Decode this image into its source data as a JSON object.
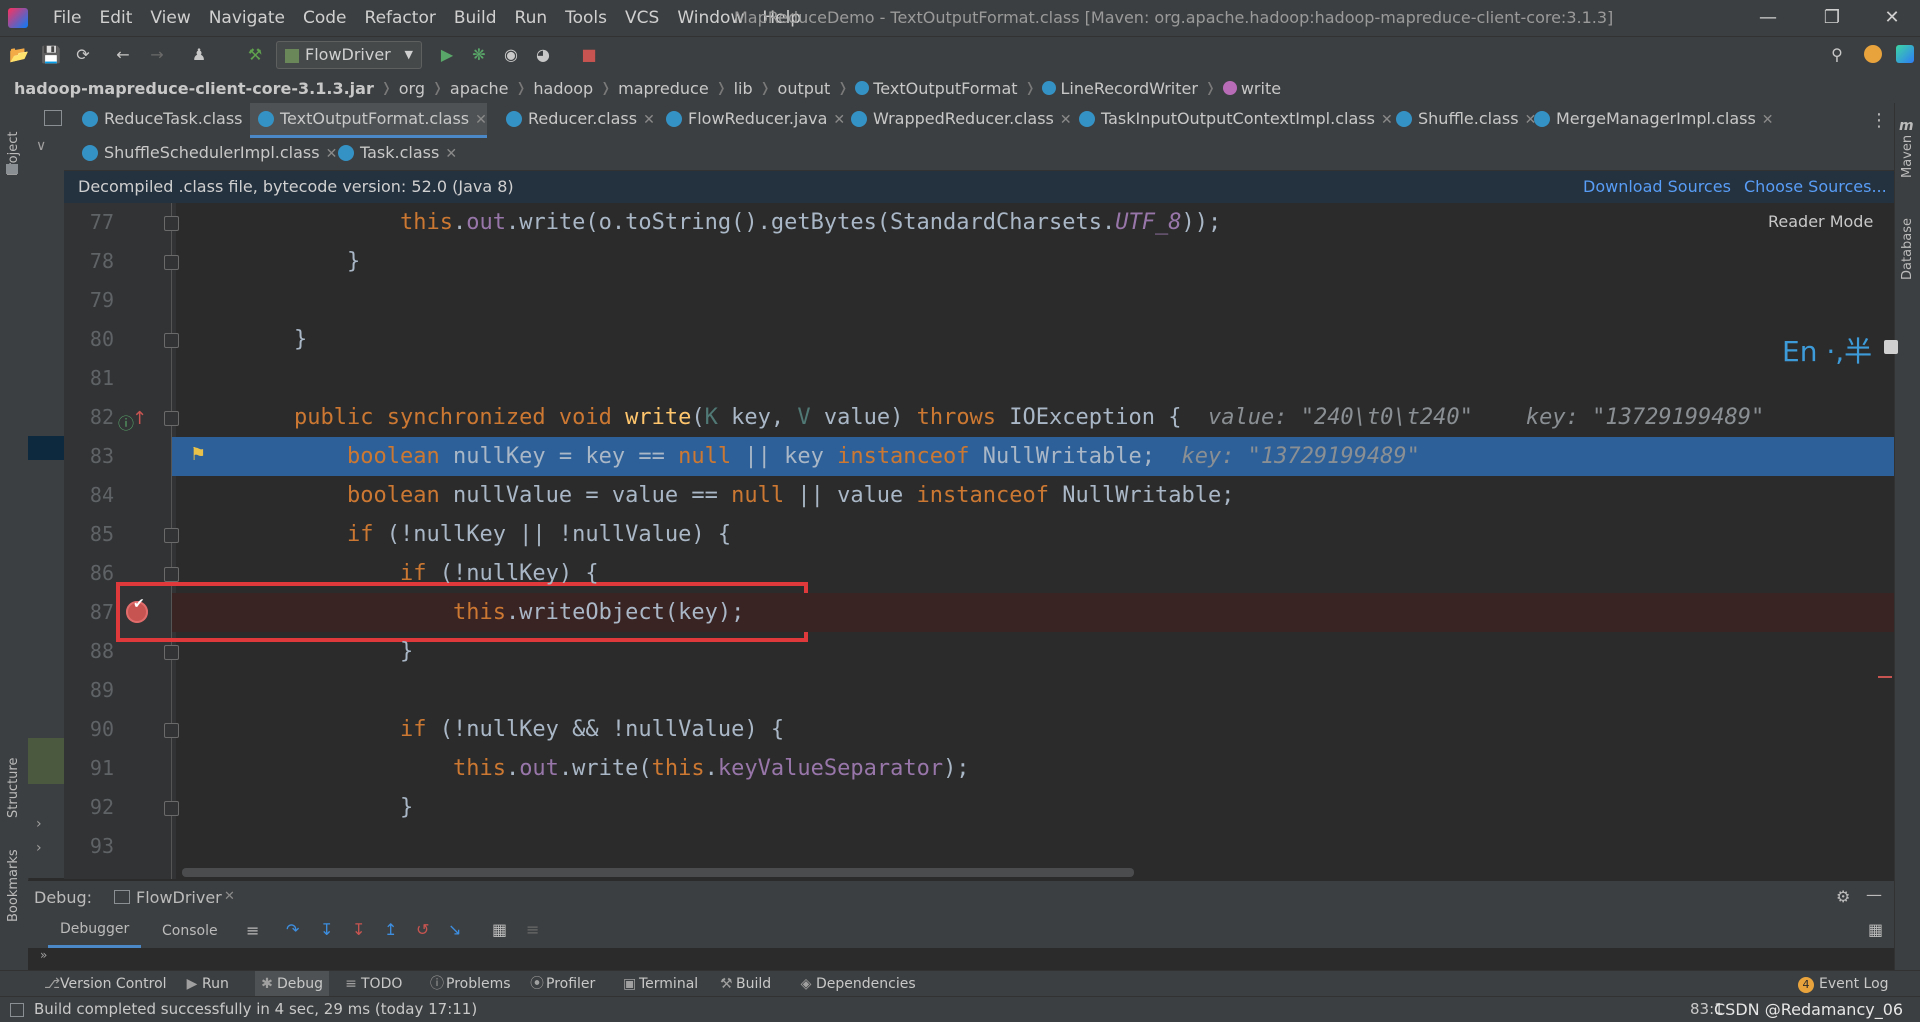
{
  "menu": [
    "File",
    "Edit",
    "View",
    "Navigate",
    "Code",
    "Refactor",
    "Build",
    "Run",
    "Tools",
    "VCS",
    "Window",
    "Help"
  ],
  "window_title": "MapReduceDemo - TextOutputFormat.class [Maven: org.apache.hadoop:hadoop-mapreduce-client-core:3.1.3]",
  "run_config": "FlowDriver",
  "breadcrumb": [
    "hadoop-mapreduce-client-core-3.1.3.jar",
    "org",
    "apache",
    "hadoop",
    "mapreduce",
    "lib",
    "output",
    "TextOutputFormat",
    "LineRecordWriter",
    "write"
  ],
  "tabs_row1": [
    "ReduceTask.class",
    "TextOutputFormat.class",
    "Reducer.class",
    "FlowReducer.java",
    "WrappedReducer.class",
    "TaskInputOutputContextImpl.class",
    "Shuffle.class",
    "MergeManagerImpl.class"
  ],
  "tabs_row2": [
    "ShuffleSchedulerImpl.class",
    "Task.class"
  ],
  "banner": {
    "text": "Decompiled .class file, bytecode version: 52.0 (Java 8)",
    "download": "Download Sources",
    "choose": "Choose Sources..."
  },
  "reader_mode": "Reader Mode",
  "ime": "En ·,半",
  "lines": [
    "77",
    "78",
    "79",
    "80",
    "81",
    "82",
    "83",
    "84",
    "85",
    "86",
    "87",
    "88",
    "89",
    "90",
    "91",
    "92",
    "93"
  ],
  "inline_hints": {
    "line82": "value: \"240\\t0\\t240\"    key: \"13729199489\"",
    "line83": "key: \"13729199489\""
  },
  "left_panel": {
    "project": "Project",
    "structure": "Structure",
    "bookmarks": "Bookmarks"
  },
  "right_panel": {
    "maven": "Maven",
    "database": "Database"
  },
  "debug": {
    "label": "Debug:",
    "session": "FlowDriver",
    "tab_debugger": "Debugger",
    "tab_console": "Console"
  },
  "bottom_tools": [
    "Version Control",
    "Run",
    "Debug",
    "TODO",
    "Problems",
    "Profiler",
    "Terminal",
    "Build",
    "Dependencies"
  ],
  "event_log": "Event Log",
  "event_count": "4",
  "status": {
    "message": "Build completed successfully in 4 sec, 29 ms (today 17:11)",
    "position": "83:1",
    "watermark": "CSDN @Redamancy_06"
  },
  "colors": {
    "keyword": "#cc7832",
    "field": "#9876aa",
    "method": "#ffc66d",
    "highlight": "#2d6099",
    "breakpoint": "#c75450",
    "annotation_box": "#e0393b"
  }
}
